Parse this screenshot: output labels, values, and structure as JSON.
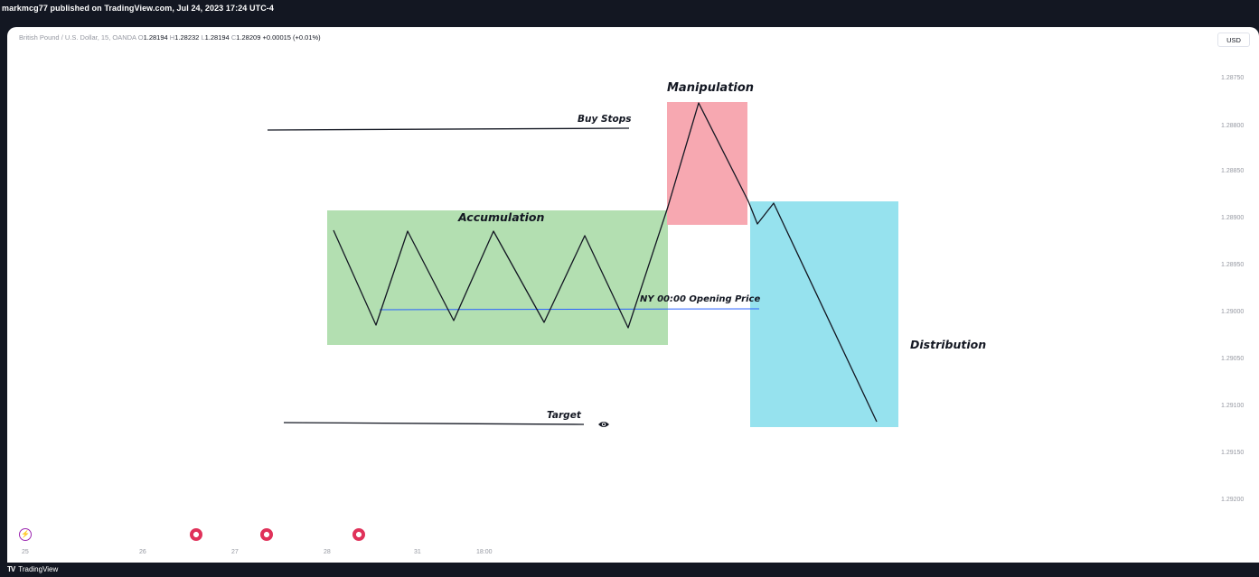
{
  "header": {
    "published_text": "markmcg77 published on TradingView.com, Jul 24, 2023 17:24 UTC-4"
  },
  "legend": {
    "symbol": "British Pound / U.S. Dollar, 15, OANDA",
    "o_label": "O",
    "o_value": "1.28194",
    "h_label": "H",
    "h_value": "1.28232",
    "l_label": "L",
    "l_value": "1.28194",
    "c_label": "C",
    "c_value": "1.28209",
    "change": "+0.00015 (+0.01%)"
  },
  "currency_button": "USD",
  "price_axis": [
    "1.28750",
    "1.28800",
    "1.28850",
    "1.28900",
    "1.28950",
    "1.29000",
    "1.29050",
    "1.29100",
    "1.29150",
    "1.29200"
  ],
  "time_axis": [
    "25",
    "26",
    "27",
    "28",
    "31",
    "18:00"
  ],
  "annotations": {
    "manipulation": "Manipulation",
    "buy_stops": "Buy Stops",
    "accumulation": "Accumulation",
    "opening_price": "NY 00:00 Opening Price",
    "distribution": "Distribution",
    "target": "Target"
  },
  "colors": {
    "accumulation_zone": "#b3dfb1",
    "manipulation_zone": "#f7a8b1",
    "distribution_zone": "#96e2ee",
    "opening_line": "#2962ff"
  },
  "footer": {
    "logo_mark": "TV",
    "brand": "TradingView"
  },
  "icons": {
    "event_bolt": "lightning-bolt-icon",
    "event_flags": "us-flag-icon",
    "visibility": "eye-icon"
  }
}
